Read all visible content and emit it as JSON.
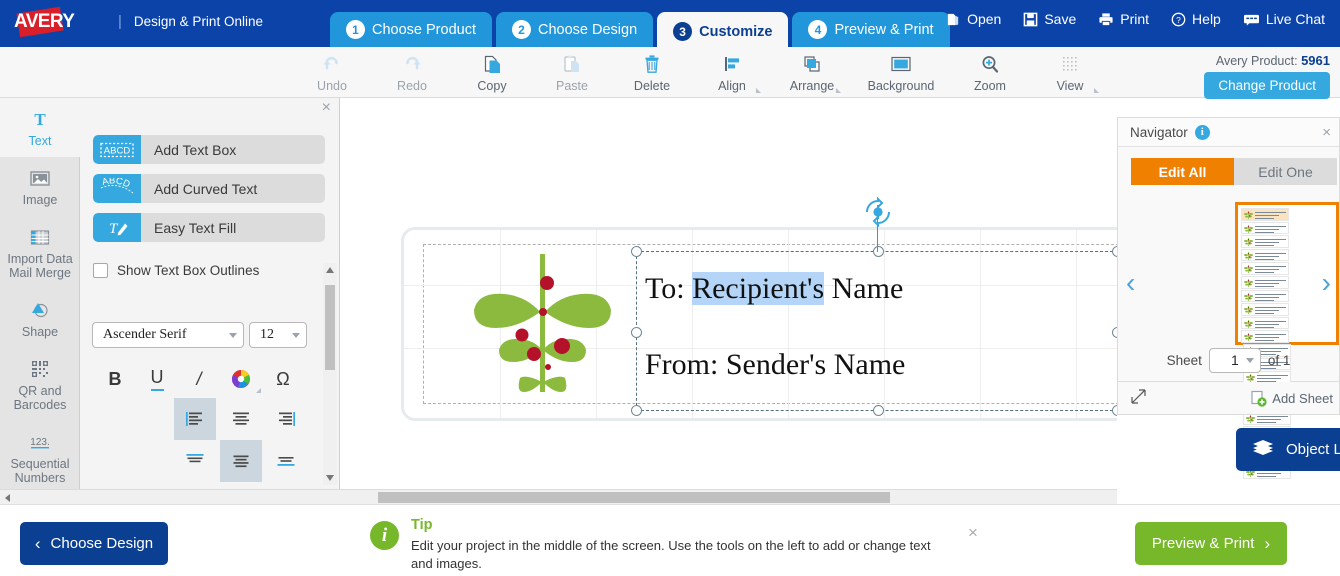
{
  "brand": {
    "logo_text": "AVERY",
    "divider": "|",
    "subtitle": "Design & Print Online"
  },
  "wizard_tabs": [
    {
      "num": "1",
      "label": "Choose Product",
      "active": false
    },
    {
      "num": "2",
      "label": "Choose Design",
      "active": false
    },
    {
      "num": "3",
      "label": "Customize",
      "active": true
    },
    {
      "num": "4",
      "label": "Preview & Print",
      "active": false
    }
  ],
  "top_actions": [
    {
      "label": "Open",
      "icon": "open-folder-icon"
    },
    {
      "label": "Save",
      "icon": "floppy-disk-icon"
    },
    {
      "label": "Print",
      "icon": "printer-icon"
    },
    {
      "label": "Help",
      "icon": "question-circle-icon"
    },
    {
      "label": "Live Chat",
      "icon": "chat-bubble-icon"
    }
  ],
  "toolbar": {
    "items": [
      {
        "label": "Undo",
        "icon": "undo-arrow-icon",
        "disabled": true,
        "caret": false
      },
      {
        "label": "Redo",
        "icon": "redo-arrow-icon",
        "disabled": true,
        "caret": false
      },
      {
        "label": "Copy",
        "icon": "copy-pages-icon",
        "disabled": false,
        "caret": false
      },
      {
        "label": "Paste",
        "icon": "clipboard-icon",
        "disabled": true,
        "caret": false
      },
      {
        "label": "Delete",
        "icon": "trash-can-icon",
        "disabled": false,
        "caret": false
      },
      {
        "label": "Align",
        "icon": "align-left-icon",
        "disabled": false,
        "caret": true
      },
      {
        "label": "Arrange",
        "icon": "arrange-layers-icon",
        "disabled": false,
        "caret": true
      },
      {
        "label": "Background",
        "icon": "background-rect-icon",
        "disabled": false,
        "caret": false
      },
      {
        "label": "Zoom",
        "icon": "magnifier-plus-icon",
        "disabled": false,
        "caret": false
      },
      {
        "label": "View",
        "icon": "grid-dots-icon",
        "disabled": false,
        "caret": true
      }
    ],
    "product_label": "Avery Product:",
    "product_number": "5961",
    "change_product_label": "Change Product"
  },
  "rail": {
    "items": [
      {
        "label": "Text",
        "icon": "text-T-icon",
        "active": true
      },
      {
        "label": "Image",
        "icon": "picture-icon",
        "active": false
      },
      {
        "label": "Import Data\nMail Merge",
        "label_l1": "Import Data",
        "label_l2": "Mail Merge",
        "icon": "table-grid-icon",
        "active": false
      },
      {
        "label": "Shape",
        "icon": "shape-triangle-icon",
        "active": false
      },
      {
        "label": "QR and\nBarcodes",
        "label_l1": "QR and",
        "label_l2": "Barcodes",
        "icon": "qr-code-icon",
        "active": false
      },
      {
        "label": "Sequential\nNumbers",
        "label_l1": "Sequential",
        "label_l2": "Numbers",
        "icon": "numbers-123-icon",
        "active": false
      }
    ]
  },
  "text_panel": {
    "close_label": "×",
    "buttons": [
      {
        "label": "Add Text Box",
        "icon": "abcd-box-icon"
      },
      {
        "label": "Add Curved Text",
        "icon": "curved-text-icon"
      },
      {
        "label": "Easy Text Fill",
        "icon": "text-fill-icon"
      }
    ],
    "checkbox_label": "Show Text Box Outlines",
    "checkbox_checked": false,
    "font_family": "Ascender Serif",
    "font_size": "12",
    "style_buttons": [
      {
        "label": "B",
        "name": "bold-button"
      },
      {
        "label": "U",
        "name": "underline-button"
      },
      {
        "label": "/",
        "name": "italic-button"
      },
      {
        "label": "",
        "name": "text-color-button"
      },
      {
        "label": "Ω",
        "name": "special-character-button"
      }
    ],
    "align_buttons": [
      {
        "name": "align-left-button",
        "selected": true
      },
      {
        "name": "align-center-button",
        "selected": false
      },
      {
        "name": "align-right-button",
        "selected": false
      },
      {
        "name": "valign-top-button",
        "selected": false
      },
      {
        "name": "valign-middle-button",
        "selected": true
      },
      {
        "name": "valign-bottom-button",
        "selected": false
      }
    ]
  },
  "canvas": {
    "textbox": {
      "line1_prefix": "To: ",
      "line1_selected": "Recipient's",
      "line1_suffix": " Name",
      "line2": "From: Sender's Name"
    },
    "clipart": "green-leaves-red-berries-icon"
  },
  "navigator": {
    "title": "Navigator",
    "info_label": "i",
    "close_label": "×",
    "edit_all_label": "Edit All",
    "edit_one_label": "Edit One",
    "edit_mode": "Edit All",
    "prev_label": "‹",
    "next_label": "›",
    "sheet_label": "Sheet",
    "sheet_value": "1",
    "sheet_of": "of 1",
    "add_sheet_label": "Add Sheet",
    "object_list_label": "Object List",
    "thumbnail_rows": 10,
    "thumbnail_cols": 2
  },
  "bottom": {
    "choose_design_label": "Choose Design",
    "choose_design_chevron": "‹",
    "tip_title": "Tip",
    "tip_text": "Edit your project in the middle of the screen. Use the tools on the left to add or change text and images.",
    "tip_close": "×",
    "preview_print_label": "Preview & Print",
    "preview_print_chevron": "›"
  },
  "colors": {
    "brand_blue": "#0b43a8",
    "tab_blue": "#2196db",
    "accent_orange": "#f08000",
    "green": "#76b82a",
    "red": "#d81f2a",
    "navy": "#0b3f91"
  }
}
